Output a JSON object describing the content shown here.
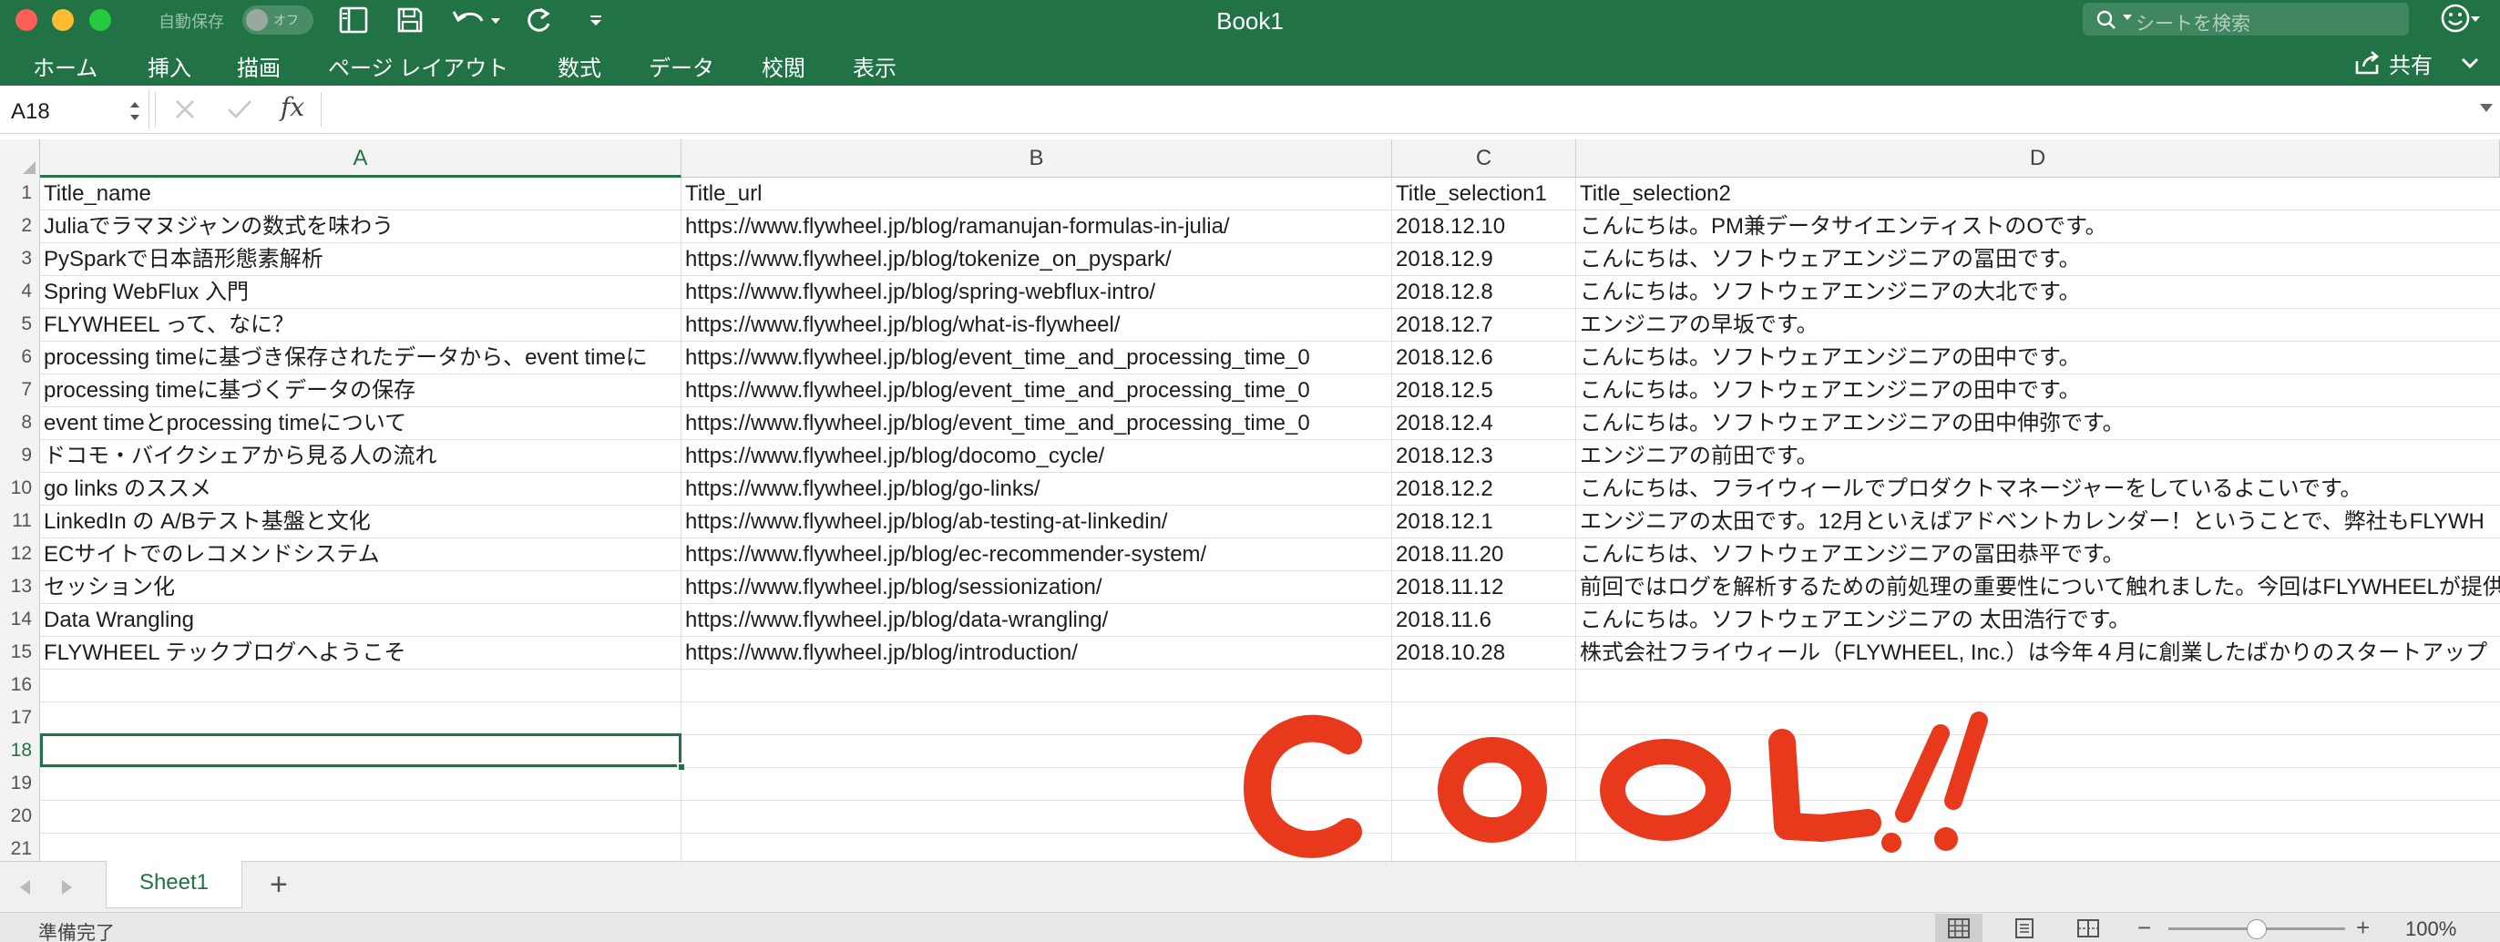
{
  "titlebar": {
    "title": "Book1",
    "autosave_label": "自動保存",
    "autosave_state": "オフ",
    "search_placeholder": "シートを検索"
  },
  "ribbon": {
    "tabs": [
      "ホーム",
      "挿入",
      "描画",
      "ページ レイアウト",
      "数式",
      "データ",
      "校閲",
      "表示"
    ],
    "share_label": "共有"
  },
  "formula_bar": {
    "name_box": "A18",
    "formula": ""
  },
  "sheet": {
    "columns": [
      {
        "label": "A",
        "active": true
      },
      {
        "label": "B",
        "active": false
      },
      {
        "label": "C",
        "active": false
      },
      {
        "label": "D",
        "active": false
      }
    ],
    "selected_cell": "A18",
    "rows": [
      {
        "n": "1",
        "cells": [
          "Title_name",
          "Title_url",
          "Title_selection1",
          "Title_selection2"
        ]
      },
      {
        "n": "2",
        "cells": [
          "Juliaでラマヌジャンの数式を味わう",
          "https://www.flywheel.jp/blog/ramanujan-formulas-in-julia/",
          "2018.12.10",
          "こんにちは。PM兼データサイエンティストのOです。"
        ]
      },
      {
        "n": "3",
        "cells": [
          "PySparkで日本語形態素解析",
          "https://www.flywheel.jp/blog/tokenize_on_pyspark/",
          "2018.12.9",
          "こんにちは、ソフトウェアエンジニアの冨田です。"
        ]
      },
      {
        "n": "4",
        "cells": [
          "Spring WebFlux 入門",
          "https://www.flywheel.jp/blog/spring-webflux-intro/",
          "2018.12.8",
          "こんにちは。ソフトウェアエンジニアの大北です。"
        ]
      },
      {
        "n": "5",
        "cells": [
          "FLYWHEEL って、なに？",
          "https://www.flywheel.jp/blog/what-is-flywheel/",
          "2018.12.7",
          "エンジニアの早坂です。"
        ]
      },
      {
        "n": "6",
        "cells": [
          "processing timeに基づき保存されたデータから、event timeに",
          "https://www.flywheel.jp/blog/event_time_and_processing_time_0",
          "2018.12.6",
          "こんにちは。ソフトウェアエンジニアの田中です。"
        ]
      },
      {
        "n": "7",
        "cells": [
          "processing timeに基づくデータの保存",
          "https://www.flywheel.jp/blog/event_time_and_processing_time_0",
          "2018.12.5",
          "こんにちは。ソフトウェアエンジニアの田中です。"
        ]
      },
      {
        "n": "8",
        "cells": [
          "event timeとprocessing timeについて",
          "https://www.flywheel.jp/blog/event_time_and_processing_time_0",
          "2018.12.4",
          "こんにちは。ソフトウェアエンジニアの田中伸弥です。"
        ]
      },
      {
        "n": "9",
        "cells": [
          "ドコモ・バイクシェアから見る人の流れ",
          "https://www.flywheel.jp/blog/docomo_cycle/",
          "2018.12.3",
          "エンジニアの前田です。"
        ]
      },
      {
        "n": "10",
        "cells": [
          "go links のススメ",
          "https://www.flywheel.jp/blog/go-links/",
          "2018.12.2",
          "こんにちは、フライウィールでプロダクトマネージャーをしているよこいです。"
        ]
      },
      {
        "n": "11",
        "cells": [
          "LinkedIn の A/Bテスト基盤と文化",
          "https://www.flywheel.jp/blog/ab-testing-at-linkedin/",
          "2018.12.1",
          "エンジニアの太田です。12月といえばアドベントカレンダー！ということで、弊社もFLYWH"
        ]
      },
      {
        "n": "12",
        "cells": [
          "ECサイトでのレコメンドシステム",
          "https://www.flywheel.jp/blog/ec-recommender-system/",
          "2018.11.20",
          "こんにちは、ソフトウェアエンジニアの冨田恭平です。"
        ]
      },
      {
        "n": "13",
        "cells": [
          "セッション化",
          "https://www.flywheel.jp/blog/sessionization/",
          "2018.11.12",
          "前回ではログを解析するための前処理の重要性について触れました。今回はFLYWHEELが提供"
        ]
      },
      {
        "n": "14",
        "cells": [
          "Data Wrangling",
          "https://www.flywheel.jp/blog/data-wrangling/",
          "2018.11.6",
          "こんにちは。ソフトウェアエンジニアの 太田浩行です。"
        ]
      },
      {
        "n": "15",
        "cells": [
          "FLYWHEEL テックブログへようこそ",
          "https://www.flywheel.jp/blog/introduction/",
          "2018.10.28",
          "株式会社フライウィール（FLYWHEEL, Inc.）は今年４月に創業したばかりのスタートアップ"
        ]
      },
      {
        "n": "16",
        "cells": [
          "",
          "",
          "",
          ""
        ]
      },
      {
        "n": "17",
        "cells": [
          "",
          "",
          "",
          ""
        ]
      },
      {
        "n": "18",
        "cells": [
          "",
          "",
          "",
          ""
        ]
      },
      {
        "n": "19",
        "cells": [
          "",
          "",
          "",
          ""
        ]
      },
      {
        "n": "20",
        "cells": [
          "",
          "",
          "",
          ""
        ]
      },
      {
        "n": "21",
        "cells": [
          "",
          "",
          "",
          ""
        ]
      }
    ]
  },
  "annotation": {
    "text": "COOL!!",
    "color": "#e8391d"
  },
  "sheet_tabs": {
    "active": "Sheet1",
    "add_label": "+"
  },
  "status_bar": {
    "status": "準備完了",
    "zoom": "100%",
    "zoom_fraction": 0.5
  },
  "colors": {
    "accent": "#217346",
    "selection": "#217346"
  }
}
